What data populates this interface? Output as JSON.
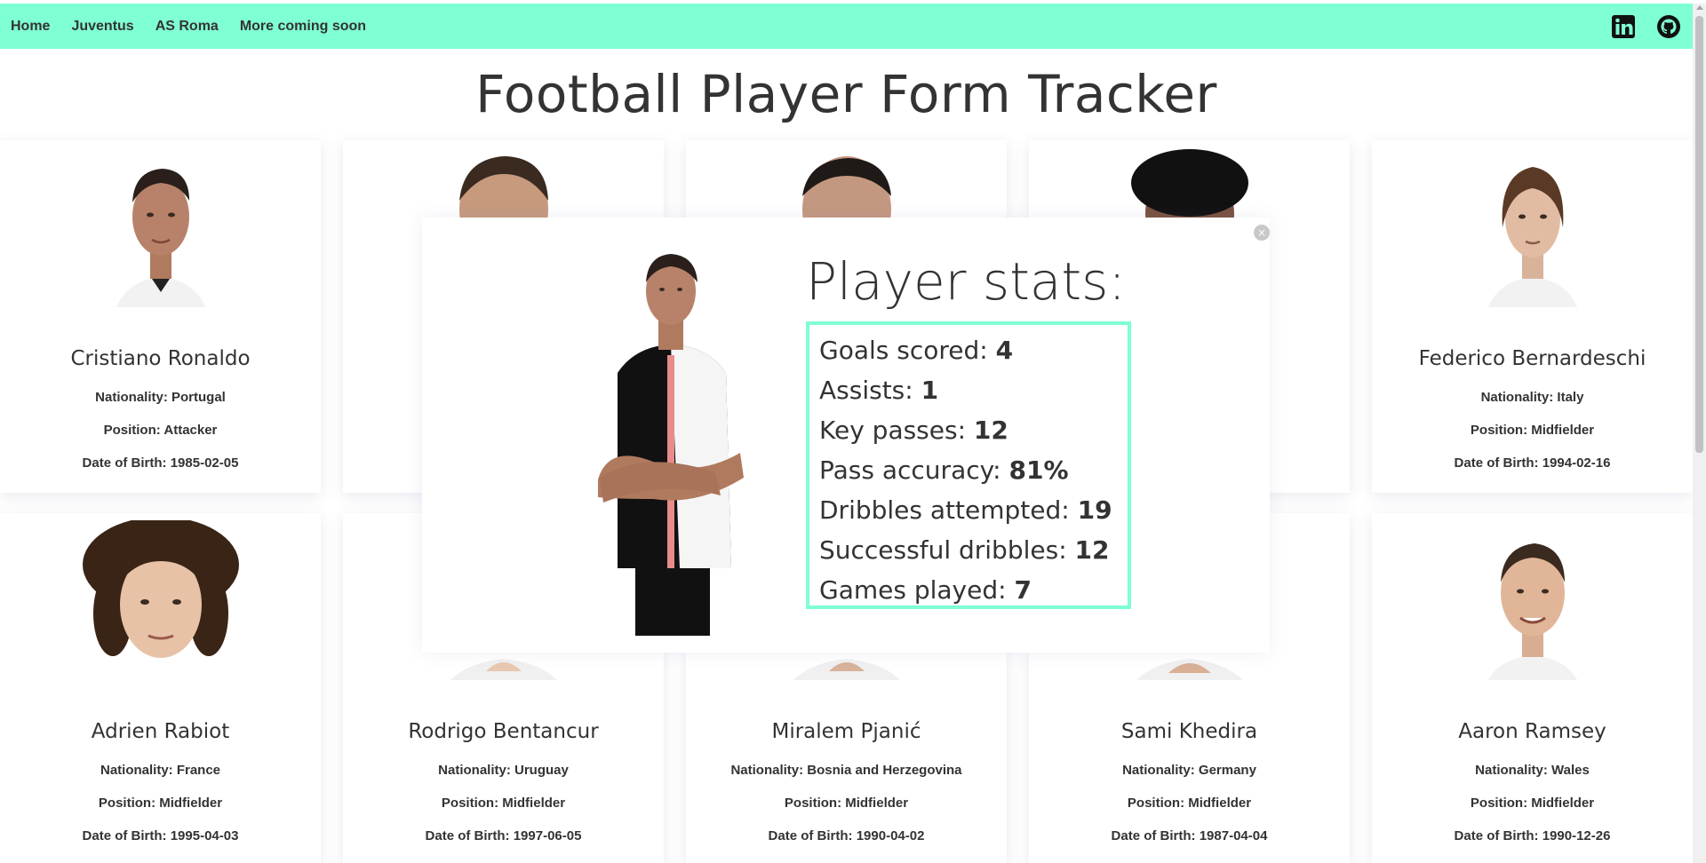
{
  "nav": {
    "links": [
      "Home",
      "Juventus",
      "AS Roma",
      "More coming soon"
    ],
    "social": {
      "linkedin": "linkedin-icon",
      "github": "github-icon"
    }
  },
  "page_title": "Football Player Form Tracker",
  "cards": [
    {
      "name": "Cristiano Ronaldo",
      "nationality": "Nationality: Portugal",
      "position": "Position: Attacker",
      "dob": "Date of Birth: 1985-02-05"
    },
    {
      "name": "",
      "nationality": "",
      "position": "",
      "dob": ""
    },
    {
      "name": "",
      "nationality": "",
      "position": "",
      "dob": ""
    },
    {
      "name": "",
      "nationality": "",
      "position": "",
      "dob": ""
    },
    {
      "name": "Federico Bernardeschi",
      "nationality": "Nationality: Italy",
      "position": "Position: Midfielder",
      "dob": "Date of Birth: 1994-02-16"
    },
    {
      "name": "Adrien Rabiot",
      "nationality": "Nationality: France",
      "position": "Position: Midfielder",
      "dob": "Date of Birth: 1995-04-03"
    },
    {
      "name": "Rodrigo Bentancur",
      "nationality": "Nationality: Uruguay",
      "position": "Position: Midfielder",
      "dob": "Date of Birth: 1997-06-05"
    },
    {
      "name": "Miralem Pjanić",
      "nationality": "Nationality: Bosnia and Herzegovina",
      "position": "Position: Midfielder",
      "dob": "Date of Birth: 1990-04-02"
    },
    {
      "name": "Sami Khedira",
      "nationality": "Nationality: Germany",
      "position": "Position: Midfielder",
      "dob": "Date of Birth: 1987-04-04"
    },
    {
      "name": "Aaron Ramsey",
      "nationality": "Nationality: Wales",
      "position": "Position: Midfielder",
      "dob": "Date of Birth: 1990-12-26"
    }
  ],
  "modal": {
    "title": "Player stats:",
    "close_icon": "close-icon",
    "stats": [
      {
        "label": "Goals scored: ",
        "value": "4"
      },
      {
        "label": "Assists: ",
        "value": "1"
      },
      {
        "label": "Key passes: ",
        "value": "12"
      },
      {
        "label": "Pass accuracy: ",
        "value": "81%"
      },
      {
        "label": "Dribbles attempted: ",
        "value": "19"
      },
      {
        "label": "Successful dribbles: ",
        "value": "12"
      },
      {
        "label": "Games played: ",
        "value": "7"
      }
    ]
  },
  "colors": {
    "accent": "#7fffd4",
    "text": "#333333"
  }
}
